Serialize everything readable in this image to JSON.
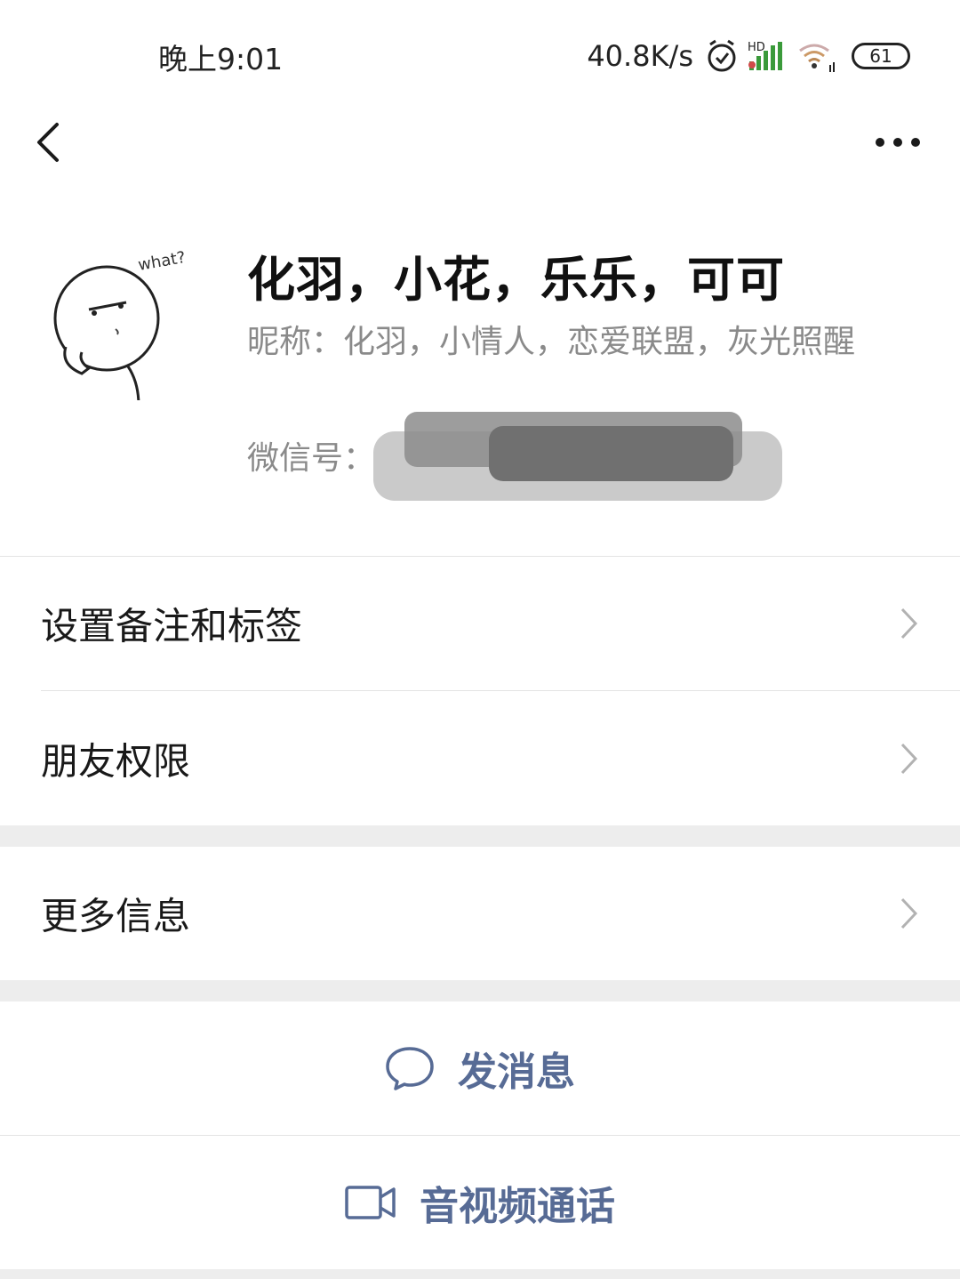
{
  "status_bar": {
    "time": "晚上9:01",
    "net_speed": "40.8K/s",
    "battery": "61",
    "icons": [
      "alarm-icon",
      "hd-signal-icon",
      "wifi-icon",
      "battery-icon"
    ]
  },
  "nav": {
    "back_icon": "chevron-left-icon",
    "more_icon": "more-dots-icon"
  },
  "profile": {
    "avatar_text": "what?",
    "name": "化羽，小花，乐乐，可可",
    "nickname": "昵称：化羽，小情人，恋爱联盟，灰光照醒",
    "wechat_id_label": "微信号："
  },
  "menu": {
    "remark_label": "设置备注和标签",
    "permissions_label": "朋友权限",
    "more_info_label": "更多信息"
  },
  "actions": {
    "message_label": "发消息",
    "call_label": "音视频通话"
  },
  "colors": {
    "action_blue": "#576b95",
    "secondary_text": "#8a8a8a",
    "gap_gray": "#ededed"
  }
}
